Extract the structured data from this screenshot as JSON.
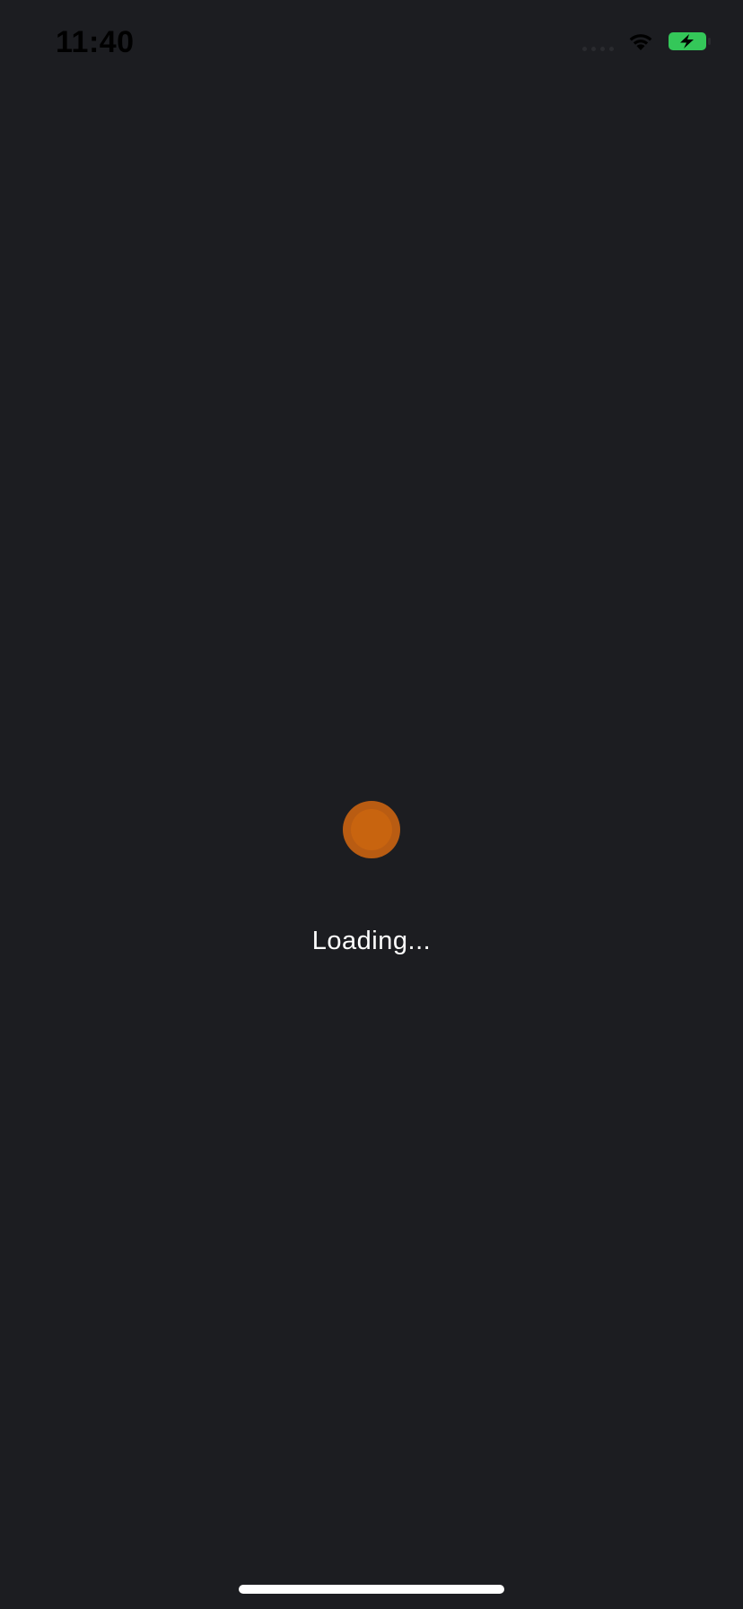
{
  "status_bar": {
    "time": "11:40",
    "icons": {
      "signal": "cellular-signal-icon",
      "wifi": "wifi-icon",
      "battery": "battery-charging-icon"
    },
    "battery_color": "#34c759"
  },
  "loader": {
    "icon": "loading-spinner-icon",
    "accent_color": "#c8640f",
    "text": "Loading..."
  }
}
